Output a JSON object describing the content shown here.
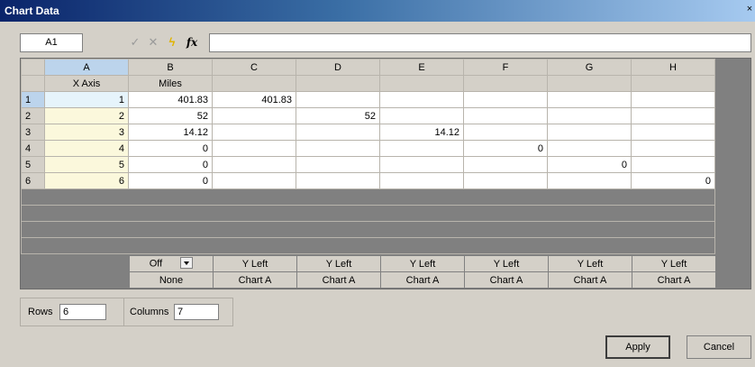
{
  "window": {
    "title": "Chart Data",
    "close_glyph": "×"
  },
  "formula_bar": {
    "cell_ref": "A1",
    "formula_value": "",
    "icons": [
      "check-icon",
      "cross-icon",
      "lightning-icon",
      "fx-icon"
    ]
  },
  "grid": {
    "columns": [
      "A",
      "B",
      "C",
      "D",
      "E",
      "F",
      "G",
      "H"
    ],
    "names": [
      "X Axis",
      "Miles",
      "",
      "",
      "",
      "",
      "",
      ""
    ],
    "rows": [
      {
        "num": "1",
        "x": "1",
        "cells": [
          "401.83",
          "401.83",
          "",
          "",
          "",
          "",
          ""
        ]
      },
      {
        "num": "2",
        "x": "2",
        "cells": [
          "52",
          "",
          "52",
          "",
          "",
          "",
          ""
        ]
      },
      {
        "num": "3",
        "x": "3",
        "cells": [
          "14.12",
          "",
          "",
          "14.12",
          "",
          "",
          ""
        ]
      },
      {
        "num": "4",
        "x": "4",
        "cells": [
          "0",
          "",
          "",
          "",
          "0",
          "",
          ""
        ]
      },
      {
        "num": "5",
        "x": "5",
        "cells": [
          "0",
          "",
          "",
          "",
          "",
          "0",
          ""
        ]
      },
      {
        "num": "6",
        "x": "6",
        "cells": [
          "0",
          "",
          "",
          "",
          "",
          "",
          "0"
        ]
      }
    ]
  },
  "series_settings": {
    "axis": [
      "Off",
      "Y Left",
      "Y Left",
      "Y Left",
      "Y Left",
      "Y Left",
      "Y Left"
    ],
    "chart": [
      "None",
      "Chart A",
      "Chart A",
      "Chart A",
      "Chart A",
      "Chart A",
      "Chart A"
    ]
  },
  "dimensions": {
    "rows_label": "Rows",
    "rows_value": "6",
    "columns_label": "Columns",
    "columns_value": "7"
  },
  "buttons": {
    "apply": "Apply",
    "cancel": "Cancel"
  },
  "colors": {
    "title_gradient_start": "#0a246a",
    "title_gradient_end": "#a6caf0",
    "selected_header": "#bcd4ec",
    "x_axis_cell": "#fbf8dc",
    "active_cell": "#e6f4fb",
    "empty_grid": "#808080"
  }
}
